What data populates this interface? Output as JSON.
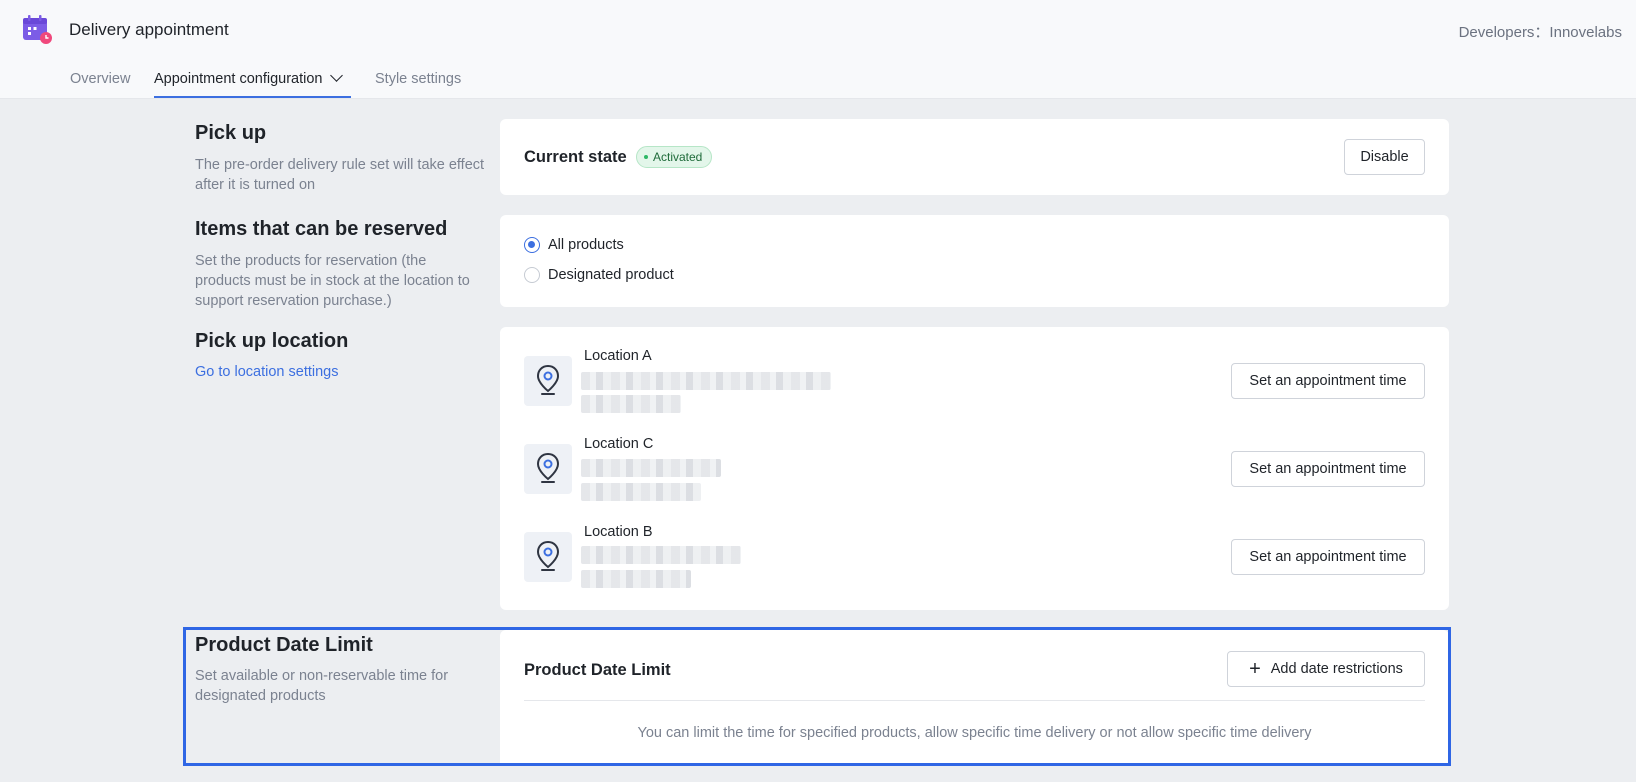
{
  "header": {
    "app_title": "Delivery appointment",
    "developer": "Developers：Innovelabs",
    "tabs": [
      "Overview",
      "Appointment configuration",
      "Style settings"
    ],
    "active_tab": "Appointment configuration"
  },
  "pickup": {
    "title": "Pick up",
    "desc": "The pre-order delivery rule set will take effect after it is turned on",
    "state_label": "Current state",
    "state_badge": "Activated",
    "disable_btn": "Disable"
  },
  "items": {
    "title": "Items that can be reserved",
    "desc": "Set the products for reservation (the products must be in stock at the location to support reservation purchase.)",
    "options": [
      "All products",
      "Designated product"
    ],
    "selected": "All products"
  },
  "location": {
    "title": "Pick up location",
    "link": "Go to location settings",
    "entries": [
      {
        "name": "Location A",
        "button": "Set an appointment time"
      },
      {
        "name": "Location C",
        "button": "Set an appointment time"
      },
      {
        "name": "Location B",
        "button": "Set an appointment time"
      }
    ]
  },
  "date_limit": {
    "title": "Product Date Limit",
    "desc": "Set available or non-reservable time for designated products",
    "card_title": "Product Date Limit",
    "add_btn": "Add date restrictions",
    "empty_text": "You can limit the time for specified products, allow specific time delivery or not allow specific time delivery"
  },
  "colors": {
    "accent": "#3c6fe0",
    "highlight": "#2f66e5",
    "active_green": "#2db866"
  }
}
